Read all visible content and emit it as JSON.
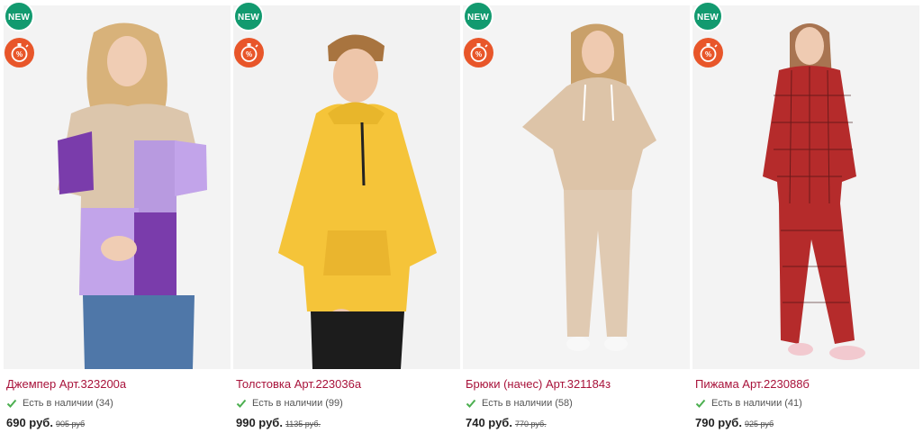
{
  "colors": {
    "new_badge": "#129a6f",
    "sale_badge": "#e8562a",
    "title": "#a8123a",
    "check": "#4caf50"
  },
  "icons": {
    "sale": "stopwatch-percent-icon",
    "stock": "check-icon"
  },
  "products": [
    {
      "badge": "NEW",
      "title": "Джемпер Арт.323200а",
      "stock": "Есть в наличии (34)",
      "price": "690 руб.",
      "old_price": "905 руб"
    },
    {
      "badge": "NEW",
      "title": "Толстовка Арт.223036а",
      "stock": "Есть в наличии (99)",
      "price": "990 руб.",
      "old_price": "1135 руб."
    },
    {
      "badge": "NEW",
      "title": "Брюки (начес) Арт.321184з",
      "stock": "Есть в наличии (58)",
      "price": "740 руб.",
      "old_price": "770 руб."
    },
    {
      "badge": "NEW",
      "title": "Пижама Арт.223088б",
      "stock": "Есть в наличии (41)",
      "price": "790 руб.",
      "old_price": "925 руб"
    }
  ]
}
